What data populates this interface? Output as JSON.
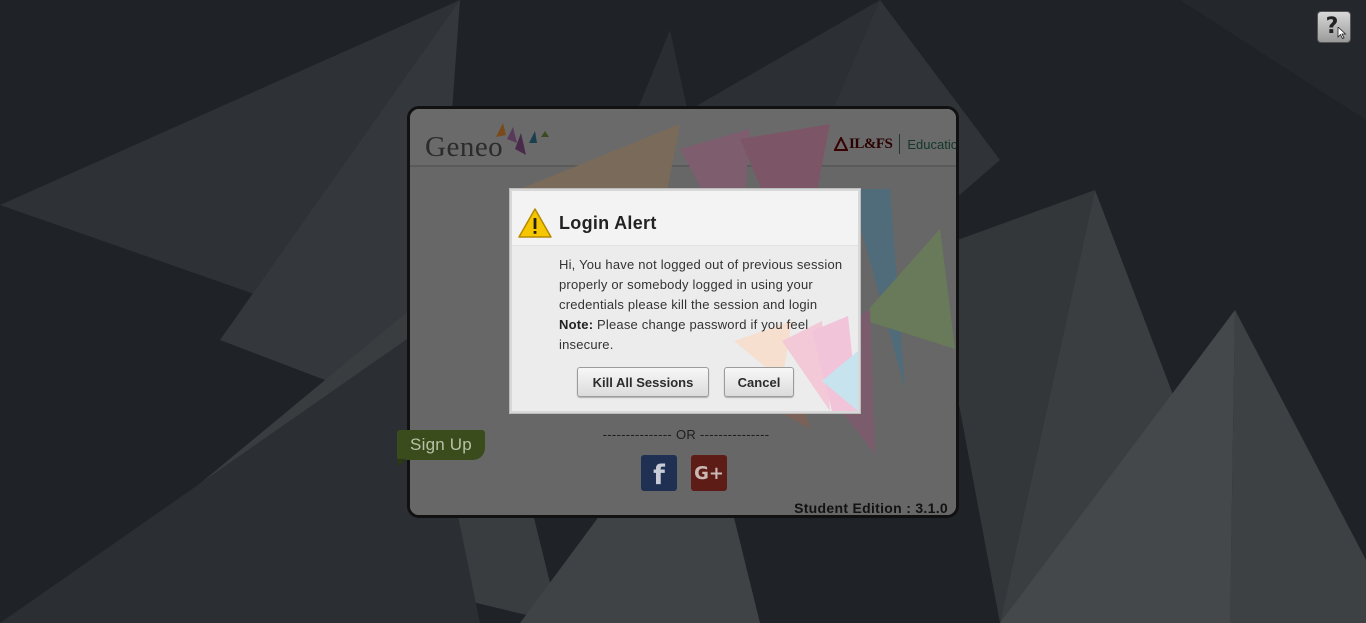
{
  "help": {
    "icon": "help-cursor-icon"
  },
  "brand": {
    "logo_text": "Geneo",
    "partner_name": "IL&FS",
    "partner_unit": "Education"
  },
  "login": {
    "or_text": "--------------- OR ---------------",
    "facebook_glyph": "f",
    "google_glyph": "G+",
    "signup_label": "Sign Up",
    "edition_text": "Student Edition : 3.1.0"
  },
  "dialog": {
    "title": "Login Alert",
    "icon": "warning-icon",
    "message_part1": "Hi, You have not logged out of previous session properly or somebody logged in using your credentials please kill the session and login ",
    "message_note_label": "Note:",
    "message_part2": " Please change password if you feel insecure.",
    "kill_button": "Kill All Sessions",
    "cancel_button": "Cancel"
  },
  "colors": {
    "background": "#1f2226",
    "dialog_bg": "#ececec",
    "signup_green": "#7a9a2e",
    "facebook_blue": "#3b5998",
    "google_red": "#c23321",
    "warning_yellow": "#f6c700"
  }
}
